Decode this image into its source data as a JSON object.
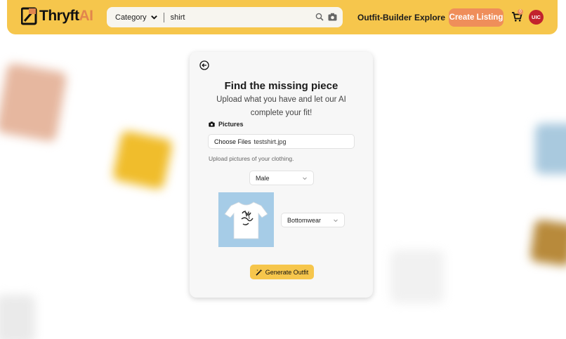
{
  "brand": {
    "name_prefix": "Thryft",
    "name_suffix": "AI"
  },
  "search": {
    "category_label": "Category",
    "query": "shirt"
  },
  "nav": {
    "outfit_builder": "Outfit-Builder",
    "explore": "Explore",
    "create_listing": "Create Listing"
  },
  "cart": {
    "count": "0"
  },
  "user": {
    "initials": "UIC"
  },
  "card": {
    "title": "Find the missing piece",
    "subtitle": "Upload what you have and let our AI complete your fit!",
    "pictures_label": "Pictures",
    "file_button": "Choose Files",
    "file_name": "testshirt.jpg",
    "help_text": "Upload pictures of your clothing.",
    "gender_value": "Male",
    "category_value": "Bottomwear",
    "generate_label": "Generate Outfit"
  },
  "colors": {
    "header": "#f6c64c",
    "accent": "#ef8e5a",
    "avatar": "#c2222d"
  }
}
